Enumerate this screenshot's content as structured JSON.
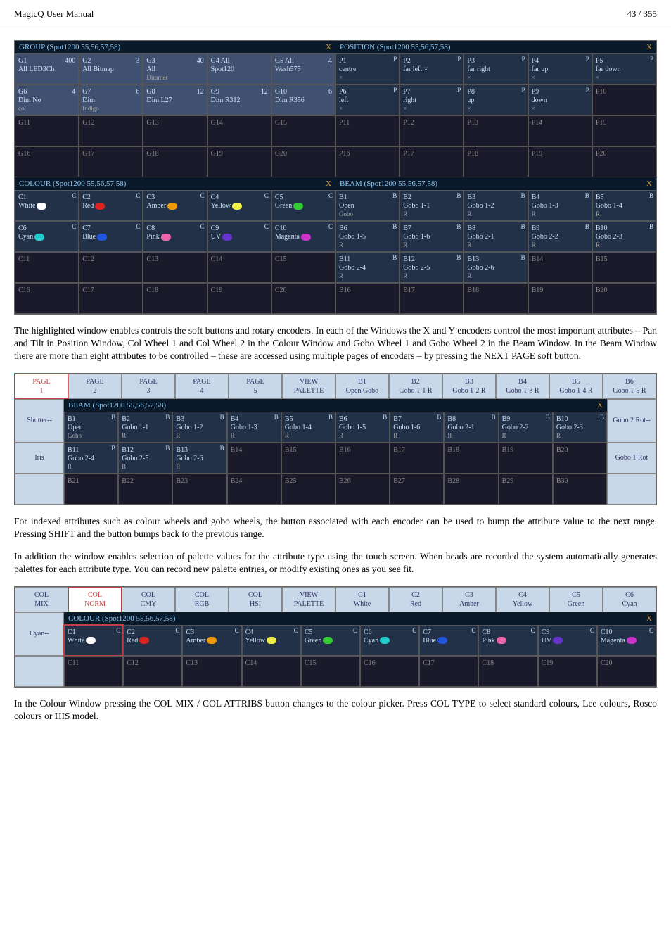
{
  "header": {
    "title": "MagicQ User Manual",
    "page": "43 / 355"
  },
  "windows": {
    "group": {
      "title": "GROUP (Spot1200 55,56,57,58)",
      "rows": [
        [
          {
            "id": "G1",
            "num": "400",
            "l": "All LED3Ch",
            "a": 1
          },
          {
            "id": "G2",
            "num": "3",
            "l": "All Bitmap",
            "a": 1
          },
          {
            "id": "G3",
            "num": "40",
            "l": "All",
            "sub": "Dimmer",
            "a": 1
          },
          {
            "id": "G4 All",
            "l": "Spot120",
            "a": 2,
            "hi": 1
          },
          {
            "id": "G5 All",
            "num": "4",
            "l": "Wash575",
            "a": 1
          }
        ],
        [
          {
            "id": "G6",
            "num": "4",
            "l": "Dim No",
            "sub": "col",
            "a": 1
          },
          {
            "id": "G7",
            "num": "6",
            "l": "Dim",
            "sub": "Indigo",
            "a": 1
          },
          {
            "id": "G8",
            "num": "12",
            "l": "Dim L27",
            "a": 1
          },
          {
            "id": "G9",
            "num": "12",
            "l": "Dim R312",
            "a": 1
          },
          {
            "id": "G10",
            "num": "6",
            "l": "Dim R356",
            "a": 1
          }
        ],
        [
          {
            "id": "G11"
          },
          {
            "id": "G12"
          },
          {
            "id": "G13"
          },
          {
            "id": "G14"
          },
          {
            "id": "G15"
          }
        ],
        [
          {
            "id": "G16"
          },
          {
            "id": "G17"
          },
          {
            "id": "G18"
          },
          {
            "id": "G19"
          },
          {
            "id": "G20"
          }
        ]
      ]
    },
    "position": {
      "title": "POSITION (Spot1200 55,56,57,58)",
      "rows": [
        [
          {
            "id": "P1",
            "tag": "P",
            "l": "centre",
            "sub": "×",
            "a": 1
          },
          {
            "id": "P2",
            "tag": "P",
            "l": "far left ×",
            "a": 1
          },
          {
            "id": "P3",
            "tag": "P",
            "l": "far right",
            "sub": "×",
            "a": 1
          },
          {
            "id": "P4",
            "tag": "P",
            "l": "far up",
            "sub": "×",
            "a": 1
          },
          {
            "id": "P5",
            "tag": "P",
            "l": "far down",
            "sub": "×",
            "a": 1
          }
        ],
        [
          {
            "id": "P6",
            "tag": "P",
            "l": "left",
            "sub": "×",
            "a": 1
          },
          {
            "id": "P7",
            "tag": "P",
            "l": "right",
            "sub": "×",
            "a": 1
          },
          {
            "id": "P8",
            "tag": "P",
            "l": "up",
            "sub": "×",
            "a": 1
          },
          {
            "id": "P9",
            "tag": "P",
            "l": "down",
            "sub": "×",
            "a": 1
          },
          {
            "id": "P10"
          }
        ],
        [
          {
            "id": "P11"
          },
          {
            "id": "P12"
          },
          {
            "id": "P13"
          },
          {
            "id": "P14"
          },
          {
            "id": "P15"
          }
        ],
        [
          {
            "id": "P16"
          },
          {
            "id": "P17"
          },
          {
            "id": "P18"
          },
          {
            "id": "P19"
          },
          {
            "id": "P20"
          }
        ]
      ]
    },
    "colour": {
      "title": "COLOUR (Spot1200 55,56,57,58)",
      "rows": [
        [
          {
            "id": "C1",
            "tag": "C",
            "l": "White",
            "a": 1,
            "sw": "#fff"
          },
          {
            "id": "C2",
            "tag": "C",
            "l": "Red",
            "a": 1,
            "sw": "#d22"
          },
          {
            "id": "C3",
            "tag": "C",
            "l": "Amber",
            "a": 1,
            "sw": "#e90"
          },
          {
            "id": "C4",
            "tag": "C",
            "l": "Yellow",
            "a": 1,
            "sw": "#ee4"
          },
          {
            "id": "C5",
            "tag": "C",
            "l": "Green",
            "a": 1,
            "sw": "#3c3"
          }
        ],
        [
          {
            "id": "C6",
            "tag": "C",
            "l": "Cyan",
            "a": 1,
            "sw": "#2cc"
          },
          {
            "id": "C7",
            "tag": "C",
            "l": "Blue",
            "a": 1,
            "sw": "#25d"
          },
          {
            "id": "C8",
            "tag": "C",
            "l": "Pink",
            "a": 1,
            "sw": "#e6a"
          },
          {
            "id": "C9",
            "tag": "C",
            "l": "UV",
            "a": 1,
            "sw": "#63c"
          },
          {
            "id": "C10",
            "tag": "C",
            "l": "Magenta",
            "a": 1,
            "sw": "#c3c"
          }
        ],
        [
          {
            "id": "C11"
          },
          {
            "id": "C12"
          },
          {
            "id": "C13"
          },
          {
            "id": "C14"
          },
          {
            "id": "C15"
          }
        ],
        [
          {
            "id": "C16"
          },
          {
            "id": "C17"
          },
          {
            "id": "C18"
          },
          {
            "id": "C19"
          },
          {
            "id": "C20"
          }
        ]
      ]
    },
    "beam": {
      "title": "BEAM (Spot1200 55,56,57,58)",
      "rows": [
        [
          {
            "id": "B1",
            "tag": "B",
            "l": "Open",
            "sub": "Gobo",
            "a": 1
          },
          {
            "id": "B2",
            "tag": "B",
            "l": "Gobo 1-1",
            "sub": "R",
            "a": 1
          },
          {
            "id": "B3",
            "tag": "B",
            "l": "Gobo 1-2",
            "sub": "R",
            "a": 1
          },
          {
            "id": "B4",
            "tag": "B",
            "l": "Gobo 1-3",
            "sub": "R",
            "a": 1
          },
          {
            "id": "B5",
            "tag": "B",
            "l": "Gobo 1-4",
            "sub": "R",
            "a": 1
          }
        ],
        [
          {
            "id": "B6",
            "tag": "B",
            "l": "Gobo 1-5",
            "sub": "R",
            "a": 1
          },
          {
            "id": "B7",
            "tag": "B",
            "l": "Gobo 1-6",
            "sub": "R",
            "a": 1
          },
          {
            "id": "B8",
            "tag": "B",
            "l": "Gobo 2-1",
            "sub": "R",
            "a": 1
          },
          {
            "id": "B9",
            "tag": "B",
            "l": "Gobo 2-2",
            "sub": "R",
            "a": 1
          },
          {
            "id": "B10",
            "tag": "B",
            "l": "Gobo 2-3",
            "sub": "R",
            "a": 1
          }
        ],
        [
          {
            "id": "B11",
            "tag": "B",
            "l": "Gobo 2-4",
            "sub": "R",
            "a": 1
          },
          {
            "id": "B12",
            "tag": "B",
            "l": "Gobo 2-5",
            "sub": "R",
            "a": 1
          },
          {
            "id": "B13",
            "tag": "B",
            "l": "Gobo 2-6",
            "sub": "R",
            "a": 1
          },
          {
            "id": "B14"
          },
          {
            "id": "B15"
          }
        ],
        [
          {
            "id": "B16"
          },
          {
            "id": "B17"
          },
          {
            "id": "B18"
          },
          {
            "id": "B19"
          },
          {
            "id": "B20"
          }
        ]
      ]
    }
  },
  "para1": "The highlighted window enables controls the soft buttons and rotary encoders. In each of the Windows the X and Y encoders control the most important attributes – Pan and Tilt in Position Window, Col Wheel 1 and Col Wheel 2 in the Colour Window and Gobo Wheel 1 and Gobo Wheel 2 in the Beam Window. In the Beam Window there are more than eight attributes to be controlled – these are accessed using multiple pages of encoders – by pressing the NEXT PAGE soft button.",
  "strip1": {
    "soft": [
      {
        "t": "PAGE",
        "s": "1",
        "sel": 1
      },
      {
        "t": "PAGE",
        "s": "2"
      },
      {
        "t": "PAGE",
        "s": "3"
      },
      {
        "t": "PAGE",
        "s": "4"
      },
      {
        "t": "PAGE",
        "s": "5"
      },
      {
        "t": "VIEW",
        "s": "PALETTE"
      },
      {
        "t": "B1",
        "s": "Open Gobo"
      },
      {
        "t": "B2",
        "s": "Gobo 1-1 R"
      },
      {
        "t": "B3",
        "s": "Gobo 1-2 R"
      },
      {
        "t": "B4",
        "s": "Gobo 1-3 R"
      },
      {
        "t": "B5",
        "s": "Gobo 1-4 R"
      },
      {
        "t": "B6",
        "s": "Gobo 1-5 R"
      }
    ],
    "side": [
      {
        "l": "Shutter",
        "sub": "--"
      },
      {
        "l": "Iris"
      }
    ],
    "side_r": [
      {
        "l": "Gobo 2 Rot",
        "sub": "--"
      },
      {
        "l": "Gobo 1 Rot"
      }
    ],
    "title": "BEAM (Spot1200 55,56,57,58)",
    "rows": [
      [
        {
          "id": "B1",
          "tag": "B",
          "l": "Open",
          "sub": "Gobo",
          "a": 1
        },
        {
          "id": "B2",
          "tag": "B",
          "l": "Gobo 1-1",
          "sub": "R",
          "a": 1
        },
        {
          "id": "B3",
          "tag": "B",
          "l": "Gobo 1-2",
          "sub": "R",
          "a": 1
        },
        {
          "id": "B4",
          "tag": "B",
          "l": "Gobo 1-3",
          "sub": "R",
          "a": 1
        },
        {
          "id": "B5",
          "tag": "B",
          "l": "Gobo 1-4",
          "sub": "R",
          "a": 1
        },
        {
          "id": "B6",
          "tag": "B",
          "l": "Gobo 1-5",
          "sub": "R",
          "a": 1
        },
        {
          "id": "B7",
          "tag": "B",
          "l": "Gobo 1-6",
          "sub": "R",
          "a": 1
        },
        {
          "id": "B8",
          "tag": "B",
          "l": "Gobo 2-1",
          "sub": "R",
          "a": 1
        },
        {
          "id": "B9",
          "tag": "B",
          "l": "Gobo 2-2",
          "sub": "R",
          "a": 1
        },
        {
          "id": "B10",
          "tag": "B",
          "l": "Gobo 2-3",
          "sub": "R",
          "a": 1
        }
      ],
      [
        {
          "id": "B11",
          "tag": "B",
          "l": "Gobo 2-4",
          "sub": "R",
          "a": 1
        },
        {
          "id": "B12",
          "tag": "B",
          "l": "Gobo 2-5",
          "sub": "R",
          "a": 1
        },
        {
          "id": "B13",
          "tag": "B",
          "l": "Gobo 2-6",
          "sub": "R",
          "a": 1
        },
        {
          "id": "B14"
        },
        {
          "id": "B15"
        },
        {
          "id": "B16"
        },
        {
          "id": "B17"
        },
        {
          "id": "B18"
        },
        {
          "id": "B19"
        },
        {
          "id": "B20"
        }
      ],
      [
        {
          "id": "B21"
        },
        {
          "id": "B22"
        },
        {
          "id": "B23"
        },
        {
          "id": "B24"
        },
        {
          "id": "B25"
        },
        {
          "id": "B26"
        },
        {
          "id": "B27"
        },
        {
          "id": "B28"
        },
        {
          "id": "B29"
        },
        {
          "id": "B30"
        }
      ]
    ]
  },
  "para2": "For indexed attributes such as colour wheels and gobo wheels, the button associated with each encoder can be used to bump the attribute value to the next range. Pressing SHIFT and the button bumps back to the previous range.",
  "para3": "In addition the window enables selection of palette values for the attribute type using the touch screen. When heads are recorded the system automatically generates palettes for each attribute type. You can record new palette entries, or modify existing ones as you see fit.",
  "strip2": {
    "soft": [
      {
        "t": "COL",
        "s": "MIX"
      },
      {
        "t": "COL",
        "s": "NORM",
        "sel": 1
      },
      {
        "t": "COL",
        "s": "CMY"
      },
      {
        "t": "COL",
        "s": "RGB"
      },
      {
        "t": "COL",
        "s": "HSI"
      },
      {
        "t": "VIEW",
        "s": "PALETTE"
      },
      {
        "t": "C1",
        "s": "White"
      },
      {
        "t": "C2",
        "s": "Red"
      },
      {
        "t": "C3",
        "s": "Amber"
      },
      {
        "t": "C4",
        "s": "Yellow"
      },
      {
        "t": "C5",
        "s": "Green"
      },
      {
        "t": "C6",
        "s": "Cyan"
      }
    ],
    "side": [
      {
        "l": "Cyan",
        "sub": "--"
      }
    ],
    "title": "COLOUR (Spot1200 55,56,57,58)",
    "rows": [
      [
        {
          "id": "C1",
          "tag": "C",
          "l": "White",
          "a": 1,
          "sw": "#fff",
          "sel": 1
        },
        {
          "id": "C2",
          "tag": "C",
          "l": "Red",
          "a": 1,
          "sw": "#d22"
        },
        {
          "id": "C3",
          "tag": "C",
          "l": "Amber",
          "a": 1,
          "sw": "#e90"
        },
        {
          "id": "C4",
          "tag": "C",
          "l": "Yellow",
          "a": 1,
          "sw": "#ee4"
        },
        {
          "id": "C5",
          "tag": "C",
          "l": "Green",
          "a": 1,
          "sw": "#3c3"
        },
        {
          "id": "C6",
          "tag": "C",
          "l": "Cyan",
          "a": 1,
          "sw": "#2cc"
        },
        {
          "id": "C7",
          "tag": "C",
          "l": "Blue",
          "a": 1,
          "sw": "#25d"
        },
        {
          "id": "C8",
          "tag": "C",
          "l": "Pink",
          "a": 1,
          "sw": "#e6a"
        },
        {
          "id": "C9",
          "tag": "C",
          "l": "UV",
          "a": 1,
          "sw": "#63c"
        },
        {
          "id": "C10",
          "tag": "C",
          "l": "Magenta",
          "a": 1,
          "sw": "#c3c"
        }
      ],
      [
        {
          "id": "C11"
        },
        {
          "id": "C12"
        },
        {
          "id": "C13"
        },
        {
          "id": "C14"
        },
        {
          "id": "C15"
        },
        {
          "id": "C16"
        },
        {
          "id": "C17"
        },
        {
          "id": "C18"
        },
        {
          "id": "C19"
        },
        {
          "id": "C20"
        }
      ]
    ]
  },
  "para4": "In the Colour Window pressing the COL MIX / COL ATTRIBS button changes to the colour picker. Press COL TYPE to select standard colours, Lee colours, Rosco colours or HIS model."
}
